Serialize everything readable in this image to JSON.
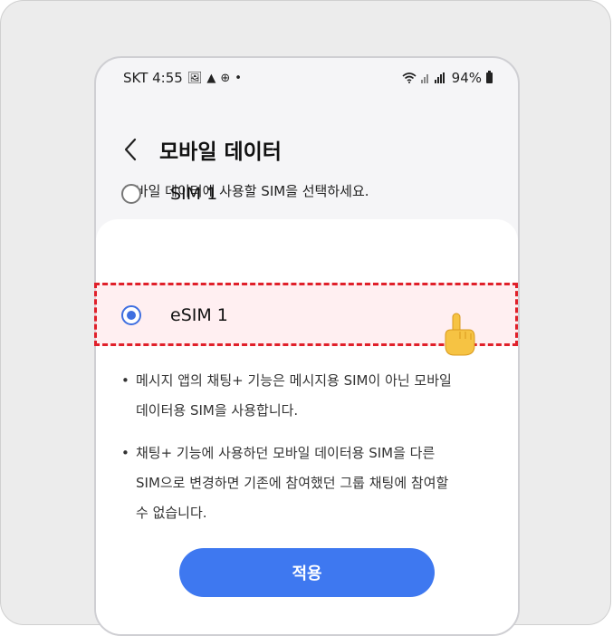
{
  "status_bar": {
    "carrier_time": "SKT 4:55",
    "dot": "•",
    "battery": "94%"
  },
  "header": {
    "title": "모바일 데이터"
  },
  "subtitle": "모바일 데이터에 사용할 SIM을 선택하세요.",
  "sim_options": [
    {
      "label": "SIM 1",
      "selected": false
    },
    {
      "label": "eSIM 1",
      "selected": true
    }
  ],
  "notes": [
    {
      "lines": [
        "메시지 앱의 채팅+ 기능은 메시지용 SIM이 아닌 모바일",
        "데이터용 SIM을 사용합니다."
      ]
    },
    {
      "lines": [
        "채팅+ 기능에 사용하던 모바일 데이터용 SIM을 다른",
        "SIM으로 변경하면 기존에 참여했던 그룹 채팅에 참여할",
        "수 없습니다."
      ]
    }
  ],
  "bullet": "•",
  "apply_label": "적용",
  "colors": {
    "accent": "#3e78f0",
    "radio_selected": "#3f6fe0",
    "highlight_border": "#e0202a"
  }
}
